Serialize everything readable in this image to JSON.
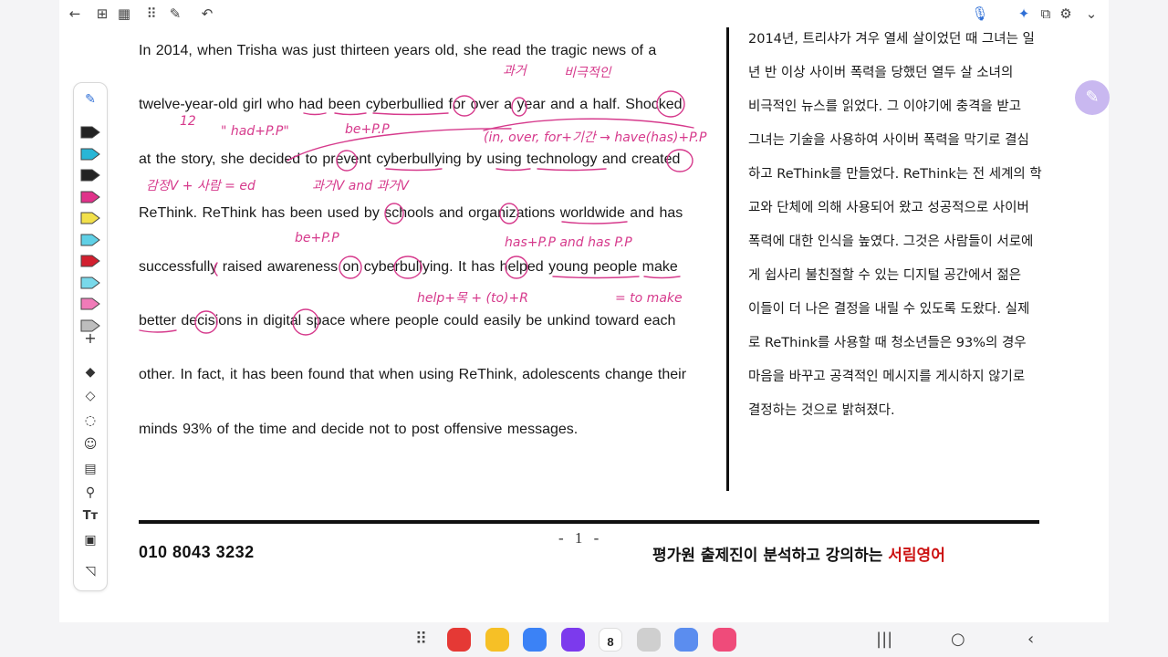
{
  "toolbar": {
    "icons": [
      "back-icon",
      "page-layout-icon",
      "grid-icon",
      "more-apps-icon",
      "edit-mode-icon",
      "undo-icon",
      "mic-icon",
      "ai-sparkle-icon",
      "pages-icon",
      "settings-icon",
      "chevron-down-icon"
    ]
  },
  "passage": {
    "lines": [
      "In 2014, when Trisha was just thirteen years old, she read the tragic news of a",
      "twelve-year-old girl who had been cyberbullied for over a year and a half. Shocked",
      "at the story, she decided to prevent cyberbullying by using technology and created",
      "ReThink. ReThink has been used by schools and organizations worldwide and has",
      "successfully raised awareness on cyberbullying. It has helped young people make",
      "better decisions in digital space where people could easily be unkind toward each",
      "other. In fact, it has been found that when using ReThink, adolescents change their",
      "minds 93% of the time and decide not to post offensive messages."
    ]
  },
  "translation": {
    "lines": [
      "2014년, 트리샤가 겨우 열세 살이었던 때 그녀는 일",
      "년 반 이상 사이버 폭력을 당했던 열두 살 소녀의",
      "비극적인 뉴스를 읽었다. 그 이야기에 충격을 받고",
      "그녀는 기술을 사용하여 사이버 폭력을 막기로 결심",
      "하고 ReThink를 만들었다. ReThink는 전 세계의 학",
      "교와 단체에 의해 사용되어 왔고 성공적으로 사이버",
      "폭력에 대한 인식을 높였다. 그것은 사람들이 서로에",
      "게 쉽사리 불친절할 수 있는 디지털 공간에서 젊은",
      "이들이 더 나은 결정을 내릴 수 있도록 도왔다. 실제",
      "로 ReThink를 사용할 때 청소년들은 93%의 경우",
      "마음을 바꾸고 공격적인 메시지를 게시하지 않기로",
      "결정하는 것으로 밝혀졌다."
    ]
  },
  "footer": {
    "page_number": "- 1 -",
    "phone": "010  8043  3232",
    "brand_prefix": "평가원 출제진이 분석하고 강의하는 ",
    "brand_name": "서림영어"
  },
  "annotations": {
    "a1": "과거",
    "a2": "비극적인",
    "a3": "12",
    "a4": "\" had+P.P\"",
    "a5": "be+P.P",
    "a6": "(in, over, for+기간 → have(has)+P.P",
    "a7": "감정V + 사람 = ed",
    "a8": "과거V  and  과거V",
    "a9": "be+P.P",
    "a10": "has+P.P  and  has P.P",
    "a11": "help+목 + (to)+R",
    "a12": "= to make"
  },
  "colors": {
    "ink": "#d63a8c",
    "brand_red": "#cc1111",
    "fab": "#c9b8f0"
  },
  "pen_toolbar": {
    "pens": [
      {
        "name": "pen-black",
        "color": "#222222"
      },
      {
        "name": "pen-cyan",
        "color": "#29b6d6"
      },
      {
        "name": "pen-black-2",
        "color": "#222222"
      },
      {
        "name": "pen-magenta",
        "color": "#e0328a"
      },
      {
        "name": "highlighter-yellow",
        "color": "#f2e04a"
      },
      {
        "name": "highlighter-cyan",
        "color": "#5fd0e6"
      },
      {
        "name": "pen-red",
        "color": "#d21f2f"
      },
      {
        "name": "highlighter-cyan-2",
        "color": "#79d9ea"
      },
      {
        "name": "highlighter-pink",
        "color": "#f07bb8"
      },
      {
        "name": "highlighter-gray",
        "color": "#bdbdbd"
      }
    ],
    "add_symbol": "+",
    "tools": [
      "eraser-icon",
      "shape-icon",
      "lasso-icon",
      "sticker-icon",
      "text-comment-icon",
      "eyedropper-icon",
      "text-box-icon",
      "image-icon",
      "page-curl-icon"
    ]
  },
  "dock": {
    "date_badge": "8",
    "apps": [
      {
        "name": "notes-app",
        "color": "#e53935"
      },
      {
        "name": "memo-app",
        "color": "#f6c026"
      },
      {
        "name": "messages-app",
        "color": "#3b82f6"
      },
      {
        "name": "internet-app",
        "color": "#7c3aed"
      },
      {
        "name": "camera-app",
        "color": "#cfcfcf"
      },
      {
        "name": "note-stack-app",
        "color": "#5b8def"
      },
      {
        "name": "gallery-app",
        "color": "#ef4b7a"
      }
    ]
  }
}
